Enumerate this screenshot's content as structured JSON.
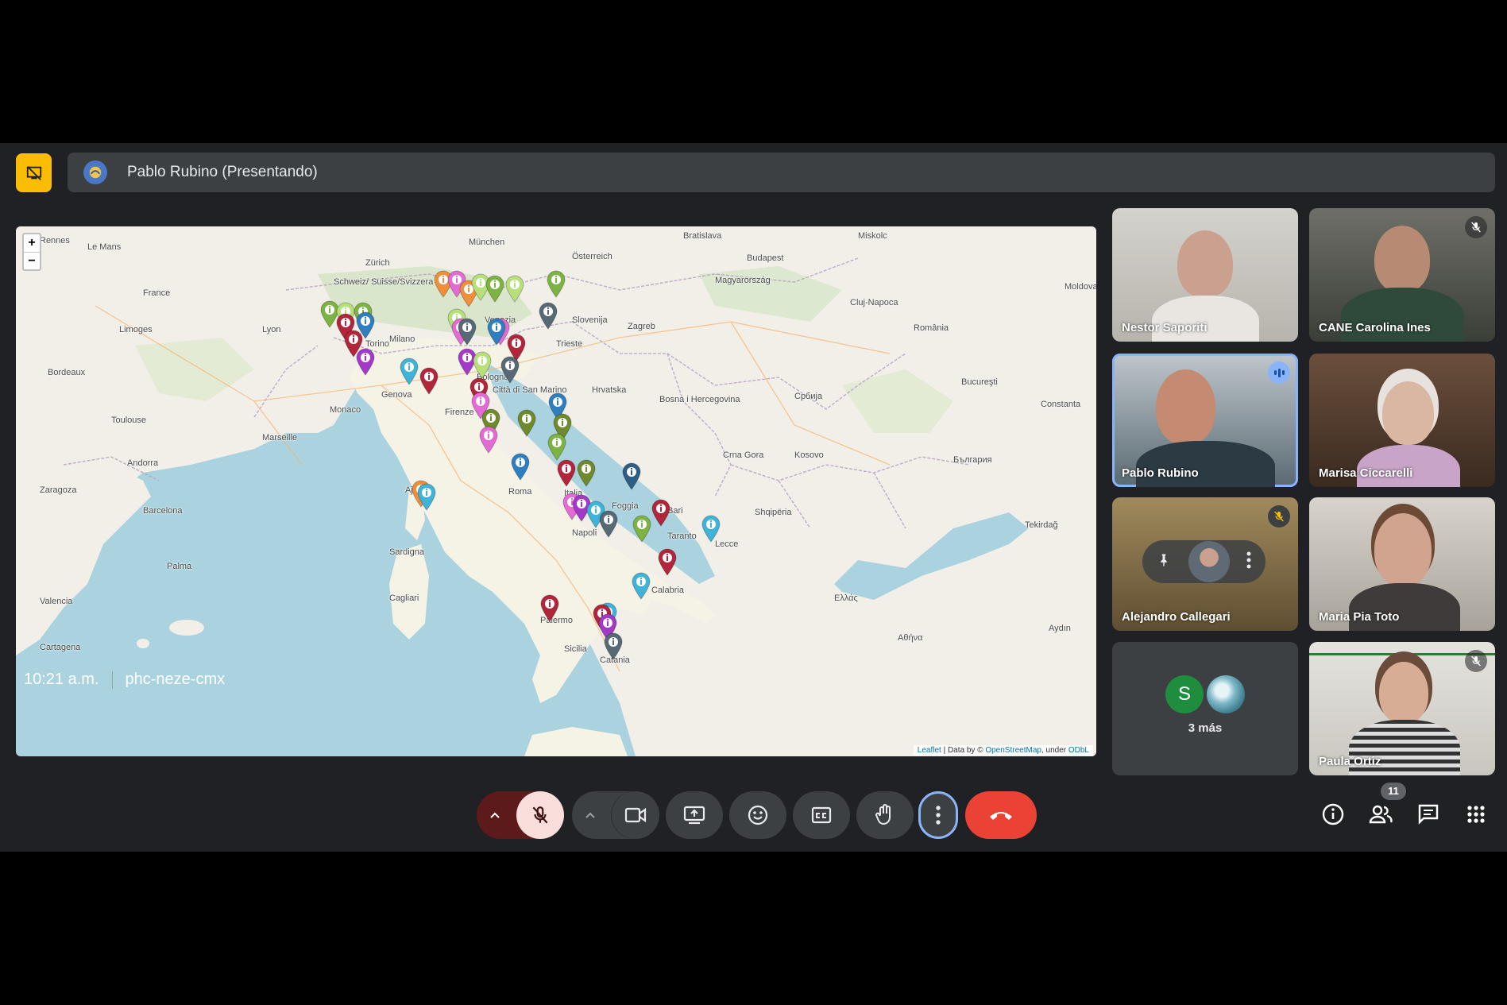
{
  "presenter": {
    "name": "Pablo Rubino (Presentando)",
    "icon": "screen-share-off-icon"
  },
  "map": {
    "zoom_in": "+",
    "zoom_out": "−",
    "attribution_leaflet": "Leaflet",
    "attribution_mid": " | Data by © ",
    "attribution_osm": "OpenStreetMap",
    "attribution_under": ", under ",
    "attribution_odbl": "ODbL",
    "places": [
      "Rennes",
      "Le Mans",
      "München",
      "Bratislava",
      "Miskolc",
      "Budapest",
      "Zürich",
      "France",
      "Schweiz/ Suisse/Svizzera",
      "Österreich",
      "Magyarország",
      "Slovenija",
      "Zagreb",
      "Cluj-Napoca",
      "Moldova",
      "Limoges",
      "Bordeaux",
      "Lyon",
      "Milano",
      "Venezia",
      "Trieste",
      "Torino",
      "Genova",
      "Bologna",
      "România",
      "Bucureşti",
      "Toulouse",
      "Monaco",
      "Marseille",
      "Firenze",
      "Città di San Marino",
      "Hrvatska",
      "Bosna i Hercegovina",
      "Србија",
      "Constanta",
      "Andorra",
      "Zaragoza",
      "Barcelona",
      "Roma",
      "Italia",
      "Crna Gora",
      "Kosovo",
      "България",
      "Ajaccio",
      "Foggia",
      "Bari",
      "Napoli",
      "Shqipëria",
      "Palma",
      "Tekirdağ",
      "Taranto",
      "Lecce",
      "Sardigna",
      "Cagliari",
      "Palermo",
      "Catania",
      "Ελλάς",
      "Αθήνα",
      "Aydın",
      "Valencia",
      "Cartagena",
      "Sicilia",
      "Calabria"
    ]
  },
  "participants": [
    {
      "name": "Nestor Saporiti",
      "muted": false
    },
    {
      "name": "CANE Carolina Ines",
      "muted": true
    },
    {
      "name": "Pablo Rubino",
      "speaking": true
    },
    {
      "name": "Marisa Ciccarelli",
      "muted": false
    },
    {
      "name": "Alejandro Callegari",
      "muted": true
    },
    {
      "name": "Maria Pia Toto",
      "muted": false
    },
    {
      "name": "Paula Ortiz",
      "muted": true
    }
  ],
  "more_participants": {
    "initial": "S",
    "label": "3 más"
  },
  "bottom": {
    "time": "10:21 a.m.",
    "meeting_code": "phc-neze-cmx",
    "people_count": "11"
  },
  "controls": [
    "mic-options-icon",
    "mic-off-icon",
    "camera-options-icon",
    "camera-icon",
    "present-screen-icon",
    "emoji-icon",
    "captions-icon",
    "raise-hand-icon",
    "more-options-icon",
    "end-call-icon"
  ],
  "side_controls": [
    "info-icon",
    "people-icon",
    "chat-icon",
    "activities-icon"
  ],
  "colors": {
    "background": "#202124",
    "surface": "#3c4043",
    "accent": "#8ab4f8",
    "danger": "#ea4335",
    "present_yellow": "#fbbc04"
  }
}
